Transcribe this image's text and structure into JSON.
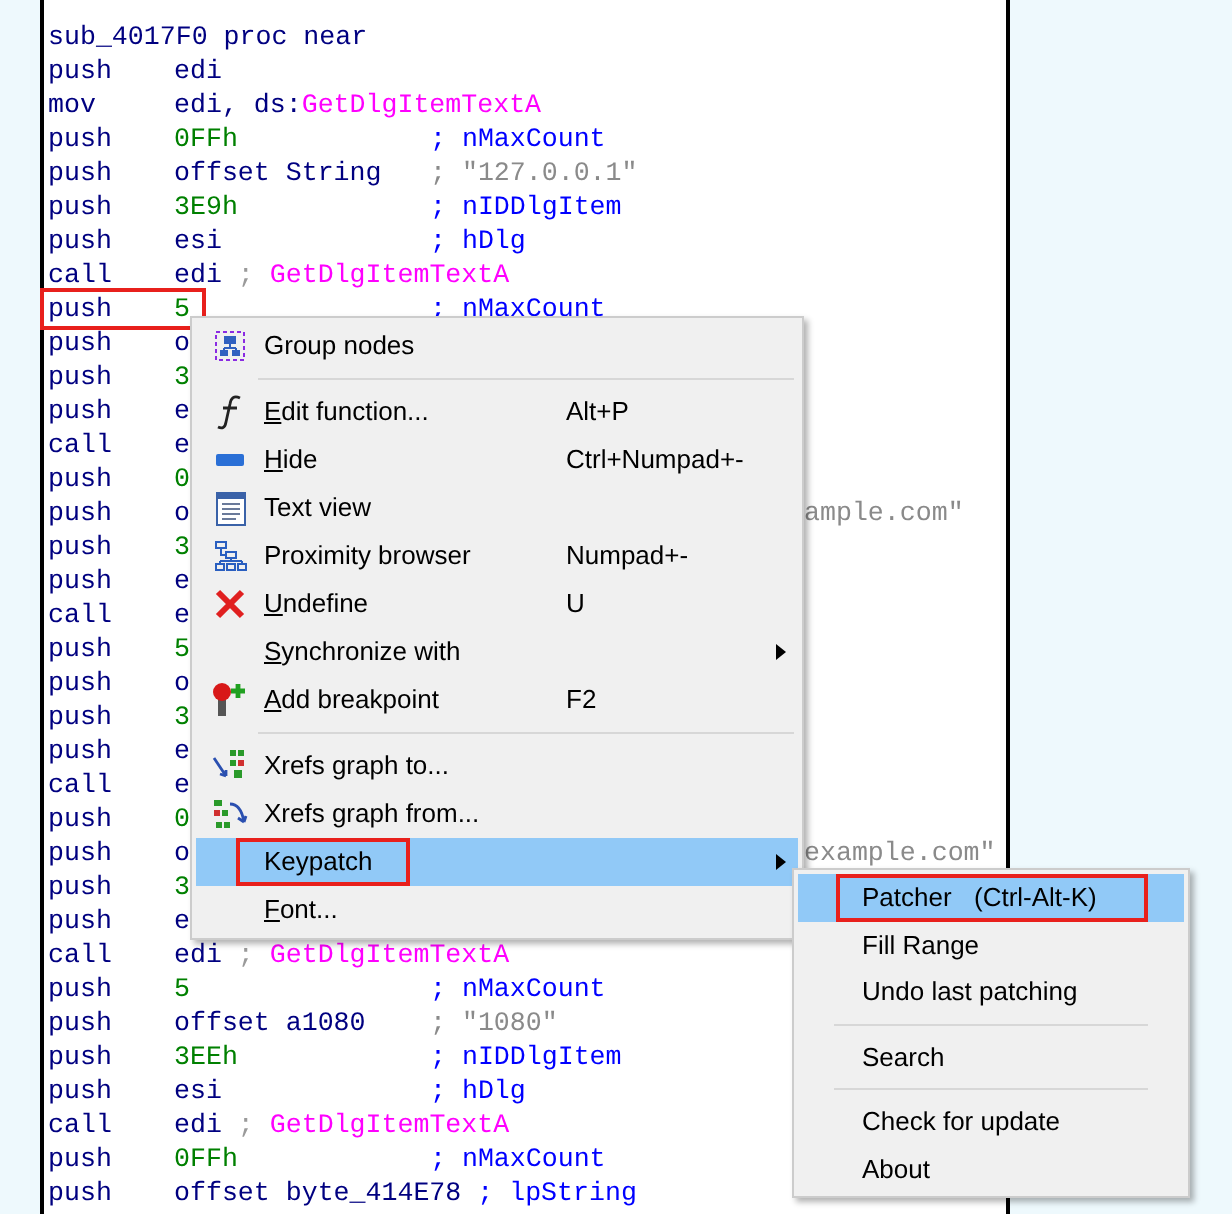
{
  "code": {
    "title": "sub_4017F0 proc near",
    "lines": [
      {
        "mnemonic": "push",
        "operand": [
          {
            "text": "edi",
            "kind": "name"
          }
        ]
      },
      {
        "mnemonic": "mov",
        "operand": [
          {
            "text": "edi, ds:",
            "kind": "name"
          },
          {
            "text": "GetDlgItemTextA",
            "kind": "import"
          }
        ]
      },
      {
        "mnemonic": "push",
        "operand": [
          {
            "text": "0FFh",
            "kind": "number"
          }
        ],
        "comment": {
          "text": "; nMaxCount",
          "kind": "name"
        }
      },
      {
        "mnemonic": "push",
        "operand": [
          {
            "text": "offset String",
            "kind": "name"
          }
        ],
        "comment": {
          "text": "; \"127.0.0.1\"",
          "kind": "string"
        }
      },
      {
        "mnemonic": "push",
        "operand": [
          {
            "text": "3E9h",
            "kind": "number"
          }
        ],
        "comment": {
          "text": "; nIDDlgItem",
          "kind": "name"
        }
      },
      {
        "mnemonic": "push",
        "operand": [
          {
            "text": "esi",
            "kind": "name"
          }
        ],
        "comment": {
          "text": "; hDlg",
          "kind": "name"
        }
      },
      {
        "mnemonic": "call",
        "operand": [
          {
            "text": "edi",
            "kind": "name"
          },
          {
            "text": " ; ",
            "kind": "punct"
          },
          {
            "text": "GetDlgItemTextA",
            "kind": "import"
          }
        ]
      },
      {
        "mnemonic": "push",
        "operand": [
          {
            "text": "5",
            "kind": "number"
          }
        ],
        "comment": {
          "text": "; nMaxCount",
          "kind": "name"
        },
        "outlined": true
      },
      {
        "mnemonic": "push",
        "operand": [
          {
            "text": "o",
            "kind": "name"
          }
        ]
      },
      {
        "mnemonic": "push",
        "operand": [
          {
            "text": "3",
            "kind": "number"
          }
        ]
      },
      {
        "mnemonic": "push",
        "operand": [
          {
            "text": "e",
            "kind": "name"
          }
        ]
      },
      {
        "mnemonic": "call",
        "operand": [
          {
            "text": "e",
            "kind": "name"
          }
        ]
      },
      {
        "mnemonic": "push",
        "operand": [
          {
            "text": "0",
            "kind": "number"
          }
        ]
      },
      {
        "mnemonic": "push",
        "operand": [
          {
            "text": "o",
            "kind": "name"
          }
        ],
        "tail": "ample.com\""
      },
      {
        "mnemonic": "push",
        "operand": [
          {
            "text": "3",
            "kind": "number"
          }
        ]
      },
      {
        "mnemonic": "push",
        "operand": [
          {
            "text": "e",
            "kind": "name"
          }
        ]
      },
      {
        "mnemonic": "call",
        "operand": [
          {
            "text": "e",
            "kind": "name"
          }
        ]
      },
      {
        "mnemonic": "push",
        "operand": [
          {
            "text": "5",
            "kind": "number"
          }
        ]
      },
      {
        "mnemonic": "push",
        "operand": [
          {
            "text": "o",
            "kind": "name"
          }
        ]
      },
      {
        "mnemonic": "push",
        "operand": [
          {
            "text": "3",
            "kind": "number"
          }
        ]
      },
      {
        "mnemonic": "push",
        "operand": [
          {
            "text": "e",
            "kind": "name"
          }
        ]
      },
      {
        "mnemonic": "call",
        "operand": [
          {
            "text": "e",
            "kind": "name"
          }
        ]
      },
      {
        "mnemonic": "push",
        "operand": [
          {
            "text": "0",
            "kind": "number"
          }
        ]
      },
      {
        "mnemonic": "push",
        "operand": [
          {
            "text": "o",
            "kind": "name"
          }
        ],
        "tail": "example.com\""
      },
      {
        "mnemonic": "push",
        "operand": [
          {
            "text": "3",
            "kind": "number"
          }
        ]
      },
      {
        "mnemonic": "push",
        "operand": [
          {
            "text": "e",
            "kind": "name"
          }
        ]
      },
      {
        "mnemonic": "call",
        "operand": [
          {
            "text": "edi",
            "kind": "name"
          },
          {
            "text": " ; ",
            "kind": "punct"
          },
          {
            "text": "GetDlgItemTextA",
            "kind": "import"
          }
        ]
      },
      {
        "mnemonic": "push",
        "operand": [
          {
            "text": "5",
            "kind": "number"
          }
        ],
        "comment": {
          "text": "; nMaxCount",
          "kind": "name"
        }
      },
      {
        "mnemonic": "push",
        "operand": [
          {
            "text": "offset a1080",
            "kind": "name"
          }
        ],
        "comment": {
          "text": "; \"1080\"",
          "kind": "string"
        }
      },
      {
        "mnemonic": "push",
        "operand": [
          {
            "text": "3EEh",
            "kind": "number"
          }
        ],
        "comment": {
          "text": "; nIDDlgItem",
          "kind": "name"
        }
      },
      {
        "mnemonic": "push",
        "operand": [
          {
            "text": "esi",
            "kind": "name"
          }
        ],
        "comment": {
          "text": "; hDlg",
          "kind": "name"
        }
      },
      {
        "mnemonic": "call",
        "operand": [
          {
            "text": "edi",
            "kind": "name"
          },
          {
            "text": " ; ",
            "kind": "punct"
          },
          {
            "text": "GetDlgItemTextA",
            "kind": "import"
          }
        ]
      },
      {
        "mnemonic": "push",
        "operand": [
          {
            "text": "0FFh",
            "kind": "number"
          }
        ],
        "comment": {
          "text": "; nMaxCount",
          "kind": "name"
        }
      },
      {
        "mnemonic": "push",
        "operand": [
          {
            "text": "offset byte_414E78",
            "kind": "name"
          }
        ],
        "comment": {
          "text": "; lpString",
          "kind": "name"
        }
      }
    ]
  },
  "context_menu": {
    "items": [
      {
        "kind": "item",
        "label": "Group nodes",
        "underlined": false,
        "selected": false
      },
      {
        "kind": "separator"
      },
      {
        "kind": "item",
        "label": "Edit function...",
        "shortcut": "Alt+P",
        "underlined": true,
        "selected": false
      },
      {
        "kind": "item",
        "label": "Hide",
        "shortcut": "Ctrl+Numpad+-",
        "underlined": true,
        "selected": false
      },
      {
        "kind": "item",
        "label": "Text view",
        "underlined": false,
        "selected": false
      },
      {
        "kind": "item",
        "label": "Proximity browser",
        "shortcut": "Numpad+-",
        "underlined": false,
        "selected": false
      },
      {
        "kind": "item",
        "label": "Undefine",
        "shortcut": "U",
        "underlined": true,
        "selected": false
      },
      {
        "kind": "item",
        "label": "Synchronize with",
        "underlined": true,
        "submenu": true,
        "selected": false
      },
      {
        "kind": "item",
        "label": "Add breakpoint",
        "shortcut": "F2",
        "underlined": true,
        "selected": false
      },
      {
        "kind": "separator"
      },
      {
        "kind": "item",
        "label": "Xrefs graph to...",
        "underlined": false,
        "selected": false
      },
      {
        "kind": "item",
        "label": "Xrefs graph from...",
        "underlined": false,
        "selected": false
      },
      {
        "kind": "item",
        "label": "Keypatch",
        "underlined": false,
        "submenu": true,
        "selected": true,
        "outlined": true
      },
      {
        "kind": "item",
        "label": "Font...",
        "underlined": true,
        "selected": false
      }
    ]
  },
  "submenu": {
    "items": [
      {
        "kind": "item",
        "label": "Patcher",
        "shortcut": "(Ctrl-Alt-K)",
        "selected": true,
        "outlined": true
      },
      {
        "kind": "item",
        "label": "Fill Range",
        "selected": false
      },
      {
        "kind": "item",
        "label": "Undo last patching",
        "selected": false
      },
      {
        "kind": "separator"
      },
      {
        "kind": "item",
        "label": "Search",
        "selected": false
      },
      {
        "kind": "separator"
      },
      {
        "kind": "item",
        "label": "Check for update",
        "selected": false
      },
      {
        "kind": "item",
        "label": "About",
        "selected": false
      }
    ]
  }
}
